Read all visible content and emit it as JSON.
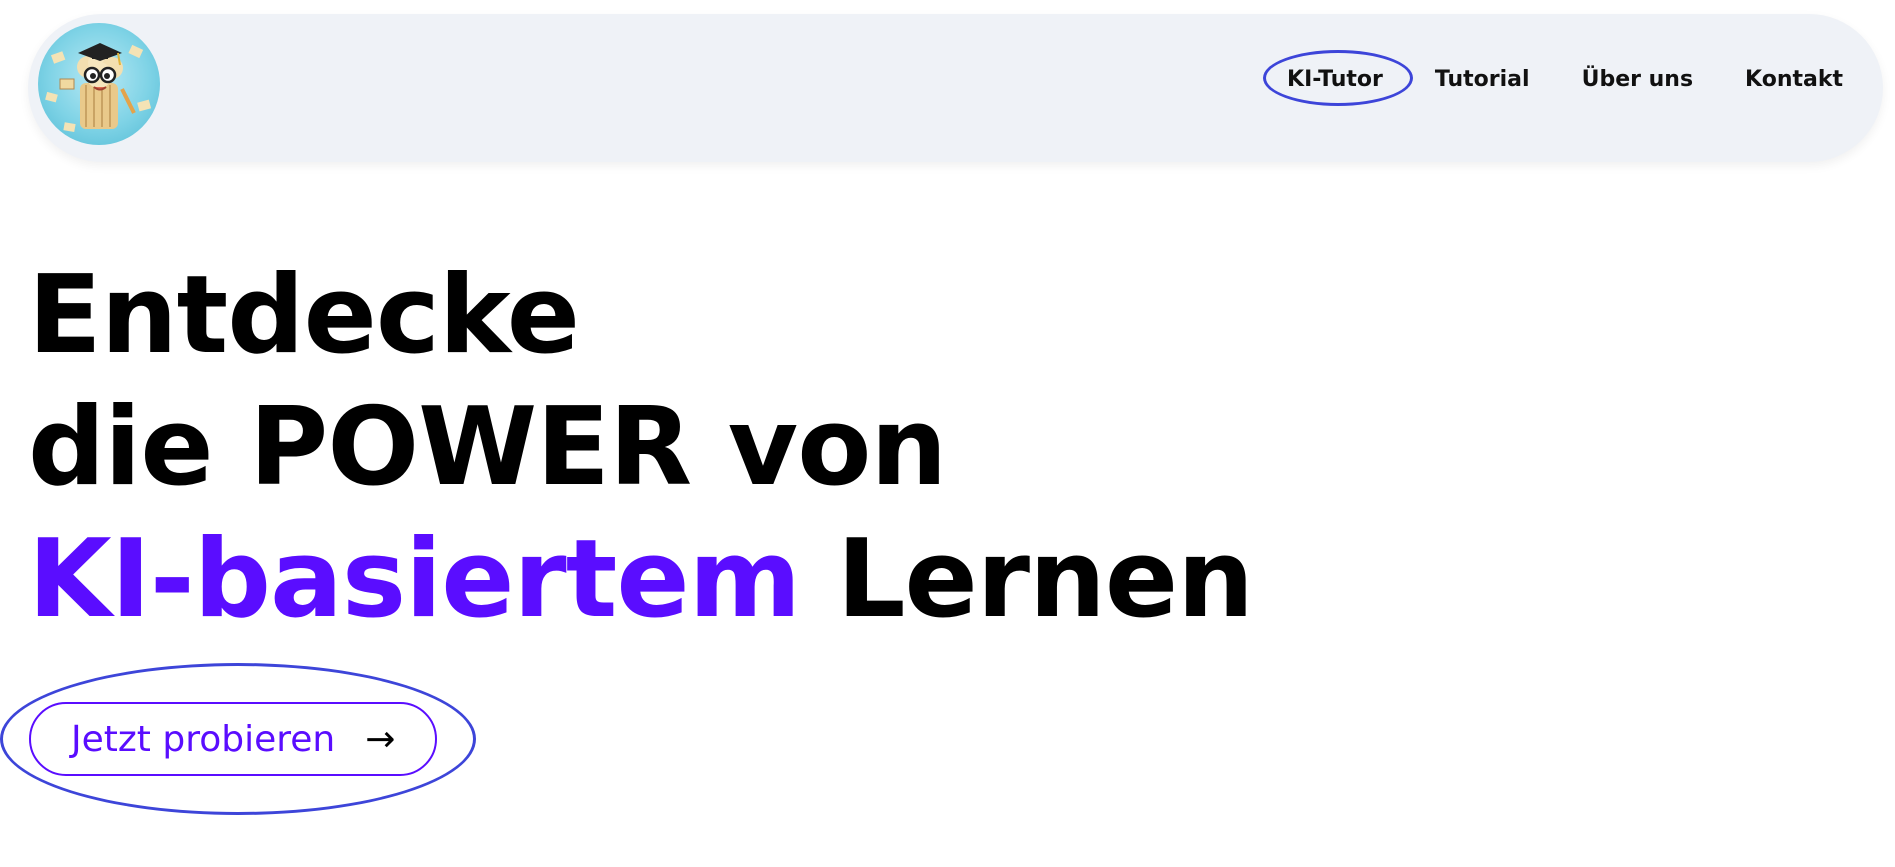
{
  "header": {
    "logo_icon": "tutor-mascot-logo-icon",
    "nav": [
      {
        "label": "KI-Tutor",
        "active": true
      },
      {
        "label": "Tutorial"
      },
      {
        "label": "Über uns"
      },
      {
        "label": "Kontakt"
      }
    ]
  },
  "hero": {
    "line1": "Entdecke",
    "line2": "die POWER von",
    "line3_accent": "KI-basiertem",
    "line3_rest": " Lernen"
  },
  "cta": {
    "label": "Jetzt probieren",
    "arrow": "→"
  },
  "colors": {
    "accent": "#5a0dff",
    "annotation_ring": "#3d45d9",
    "header_bg": "#eff2f7"
  }
}
